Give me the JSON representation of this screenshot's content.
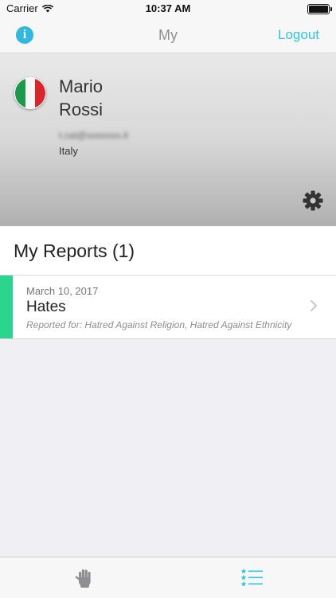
{
  "status_bar": {
    "carrier": "Carrier",
    "time": "10:37 AM"
  },
  "nav": {
    "title": "My",
    "logout_label": "Logout",
    "info_icon": "info-icon"
  },
  "profile": {
    "first_name": "Mario",
    "last_name": "Rossi",
    "email": "t.cat@sosssss.it",
    "country": "Italy",
    "flag": "italy-flag"
  },
  "reports": {
    "header": "My Reports (1)",
    "items": [
      {
        "date": "March 10, 2017",
        "title": "Hates",
        "subtitle": "Reported for: Hatred Against Religion, Hatred Against Ethnicity",
        "accent_color": "#2bd58e"
      }
    ]
  },
  "tab_bar": {
    "tabs": [
      {
        "icon": "hand-icon"
      },
      {
        "icon": "list-icon"
      }
    ]
  },
  "colors": {
    "accent": "#2ec4e2",
    "report_accent": "#2bd58e",
    "icon_gray": "#8e8e93"
  }
}
